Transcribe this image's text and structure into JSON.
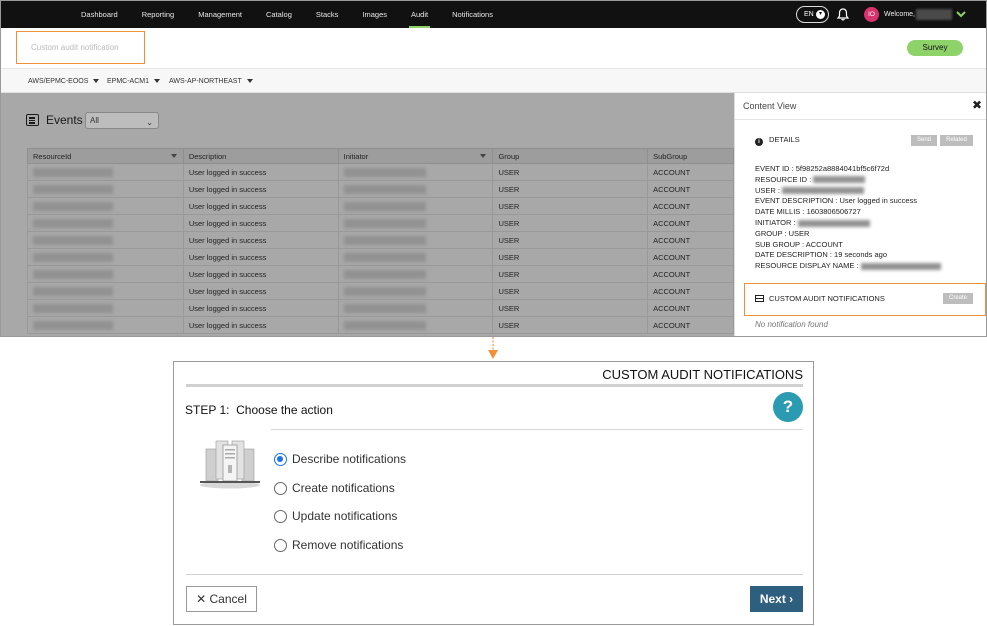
{
  "nav": {
    "items": [
      "Dashboard",
      "Reporting",
      "Management",
      "Catalog",
      "Stacks",
      "Images",
      "Audit",
      "Notifications"
    ],
    "active": "Audit",
    "lang": "EN",
    "avatar_initials": "IO",
    "welcome": "Welcome,"
  },
  "subheader": {
    "audit_field_text": "Custom audit notification",
    "survey_label": "Survey"
  },
  "crumbs": [
    "AWS/EPMC-EOOS",
    "EPMC-ACM1",
    "AWS-AP-NORTHEAST"
  ],
  "events": {
    "title": "Events",
    "filter_value": "All",
    "columns": [
      "ResourceId",
      "Description",
      "Initiator",
      "Group",
      "SubGroup"
    ],
    "rows": [
      {
        "description": "User logged in success",
        "group": "USER",
        "subgroup": "ACCOUNT"
      },
      {
        "description": "User logged in success",
        "group": "USER",
        "subgroup": "ACCOUNT"
      },
      {
        "description": "User logged in success",
        "group": "USER",
        "subgroup": "ACCOUNT"
      },
      {
        "description": "User logged in success",
        "group": "USER",
        "subgroup": "ACCOUNT"
      },
      {
        "description": "User logged in success",
        "group": "USER",
        "subgroup": "ACCOUNT"
      },
      {
        "description": "User logged in success",
        "group": "USER",
        "subgroup": "ACCOUNT"
      },
      {
        "description": "User logged in success",
        "group": "USER",
        "subgroup": "ACCOUNT"
      },
      {
        "description": "User logged in success",
        "group": "USER",
        "subgroup": "ACCOUNT"
      },
      {
        "description": "User logged in success",
        "group": "USER",
        "subgroup": "ACCOUNT"
      },
      {
        "description": "User logged in success",
        "group": "USER",
        "subgroup": "ACCOUNT"
      }
    ]
  },
  "content_view": {
    "title": "Content View",
    "details_label": "DETAILS",
    "send_label": "Send",
    "related_label": "Related",
    "details": [
      {
        "label": "EVENT ID :",
        "value": "5f98252a8884041bf5c6f72d"
      },
      {
        "label": "RESOURCE ID :",
        "value": ""
      },
      {
        "label": "USER :",
        "value": ""
      },
      {
        "label": "EVENT DESCRIPTION :",
        "value": "User logged in success"
      },
      {
        "label": "DATE MILLIS :",
        "value": "1603806506727"
      },
      {
        "label": "INITIATOR :",
        "value": ""
      },
      {
        "label": "GROUP :",
        "value": "USER"
      },
      {
        "label": "SUB GROUP :",
        "value": "ACCOUNT"
      },
      {
        "label": "DATE DESCRIPTION :",
        "value": "19 seconds ago"
      },
      {
        "label": "RESOURCE DISPLAY NAME :",
        "value": ""
      }
    ],
    "notifications_label": "CUSTOM AUDIT NOTIFICATIONS",
    "create_label": "Create",
    "empty_text": "No notification found"
  },
  "dialog": {
    "title": "CUSTOM AUDIT NOTIFICATIONS",
    "step_label": "STEP 1:",
    "step_text": "Choose the action",
    "help": "?",
    "options": [
      "Describe notifications",
      "Create notifications",
      "Update notifications",
      "Remove notifications"
    ],
    "selected_index": 0,
    "cancel_label": "Cancel",
    "next_label": "Next"
  },
  "colors": {
    "accent_green": "#8ed26a",
    "highlight_orange": "#f0903c",
    "help_teal": "#2a9bb0",
    "next_blue": "#2f5f7e",
    "radio_blue": "#1a73e8"
  }
}
